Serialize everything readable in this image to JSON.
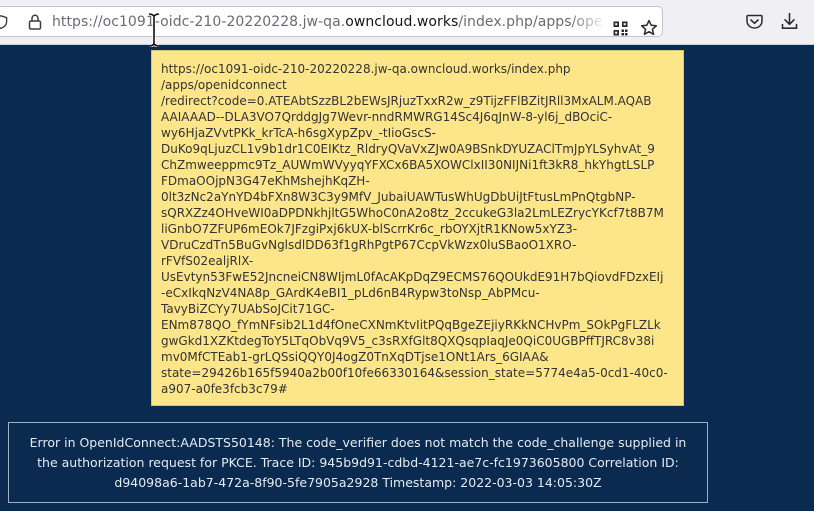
{
  "browser": {
    "url_prefix": "https://oc1091-oidc-210-20220228.jw-qa.",
    "url_domain": "owncloud.works",
    "url_suffix": "/index.php/apps/openidconnect/redirect?code=0.ATEAbtSzzBL2bEWsJRjuzTxxR2w"
  },
  "tooltip": {
    "lines": [
      "https://oc1091-oidc-210-20220228.jw-qa.owncloud.works/index.php",
      "/apps/openidconnect",
      "/redirect?code=0.ATEAbtSzzBL2bEWsJRjuzTxxR2w_z9TijzFFlBZitJRll3MxALM.AQAB",
      "AAIAAAD--DLA3VO7QrddgJg7Wevr-nndRMWRG14Sc4J6qJnW-8-yl6j_dBOciC-",
      "wy6HjaZVvtPKk_krTcA-h6sgXypZpv_-tIioGscS-",
      "DuKo9qLjuzCL1v9b1dr1C0EIKtz_RldryQVaVxZJw0A9BSnkDYUZAClTmJpYLSyhvAt_9",
      "ChZmweeppmc9Tz_AUWmWVyyqYFXCx6BA5XOWClxII30NIJNi1ft3kR8_hkYhgtLSLP",
      "FDmaOOjpN3G47eKhMshejhKqZH-",
      "0lt3zNc2aYnYD4bFXn8W3C3y9MfV_JubaiUAWTusWhUgDbUiJtFtusLmPnQtgbNP-",
      "sQRXZz4OHveWI0aDPDNkhjltG5WhoC0nA2o8tz_2ccukeG3la2LmLEZrycYKcf7t8B7M",
      "liGnbO7ZFUP6mEOk7JFzgiPxj6kUX-blScrrKr6c_rbOYXjtR1KNow5xYZ3-",
      "VDruCzdTn5BuGvNglsdlDD63f1gRhPgtP67CcpVkWzx0luSBaoO1XRO-",
      "rFVfS02ealjRlX-",
      "UsEvtyn53FwE52JncneiCN8WIjmL0fAcAKpDqZ9ECMS76QOUkdE91H7bQiovdFDzxEIj",
      "-eCxIkqNzV4NA8p_GArdK4eBI1_pLd6nB4Rypw3toNsp_AbPMcu-",
      "TavyBiZCYy7UAbSoJCit71GC-",
      "ENm878QO_fYmNFsib2L1d4fOneCXNmKtvIitPQqBgeZEjiyRKkNCHvPm_SOkPgFLZLk",
      "gwGkd1XZKtdegToY5LTqObVq9V5_c3sRXfGlt8QXQsqpIaqJe0QiC0UGBPffTJRC8v38i",
      "mv0MfCTEab1-grLQSsiQQY0J4ogZ0TnXqDTjse1ONt1Ars_6GIAA&",
      "state=29426b165f5940a2b00f10fe66330164&session_state=5774e4a5-0cd1-40c0-",
      "a907-a0fe3fcb3c79#"
    ]
  },
  "error": {
    "message": "Error in OpenIdConnect:AADSTS50148: The code_verifier does not match the code_challenge supplied in the authorization request for PKCE. Trace ID: 945b9d91-cdbd-4121-ae7c-fc1973605800 Correlation ID: d94098a6-1ab7-472a-8f90-5fe7905a2928 Timestamp: 2022-03-03 14:05:30Z"
  },
  "icons": {
    "shield": "shield-icon",
    "lock": "lock-icon",
    "qr": "qr-code-icon",
    "star": "bookmark-star-icon",
    "pocket": "pocket-icon",
    "download": "download-icon",
    "cursor": "text-cursor-icon"
  },
  "colors": {
    "page_background": "#0a2a4f",
    "tooltip_background": "#fde68a",
    "toolbar_background": "#f0f0f4"
  }
}
